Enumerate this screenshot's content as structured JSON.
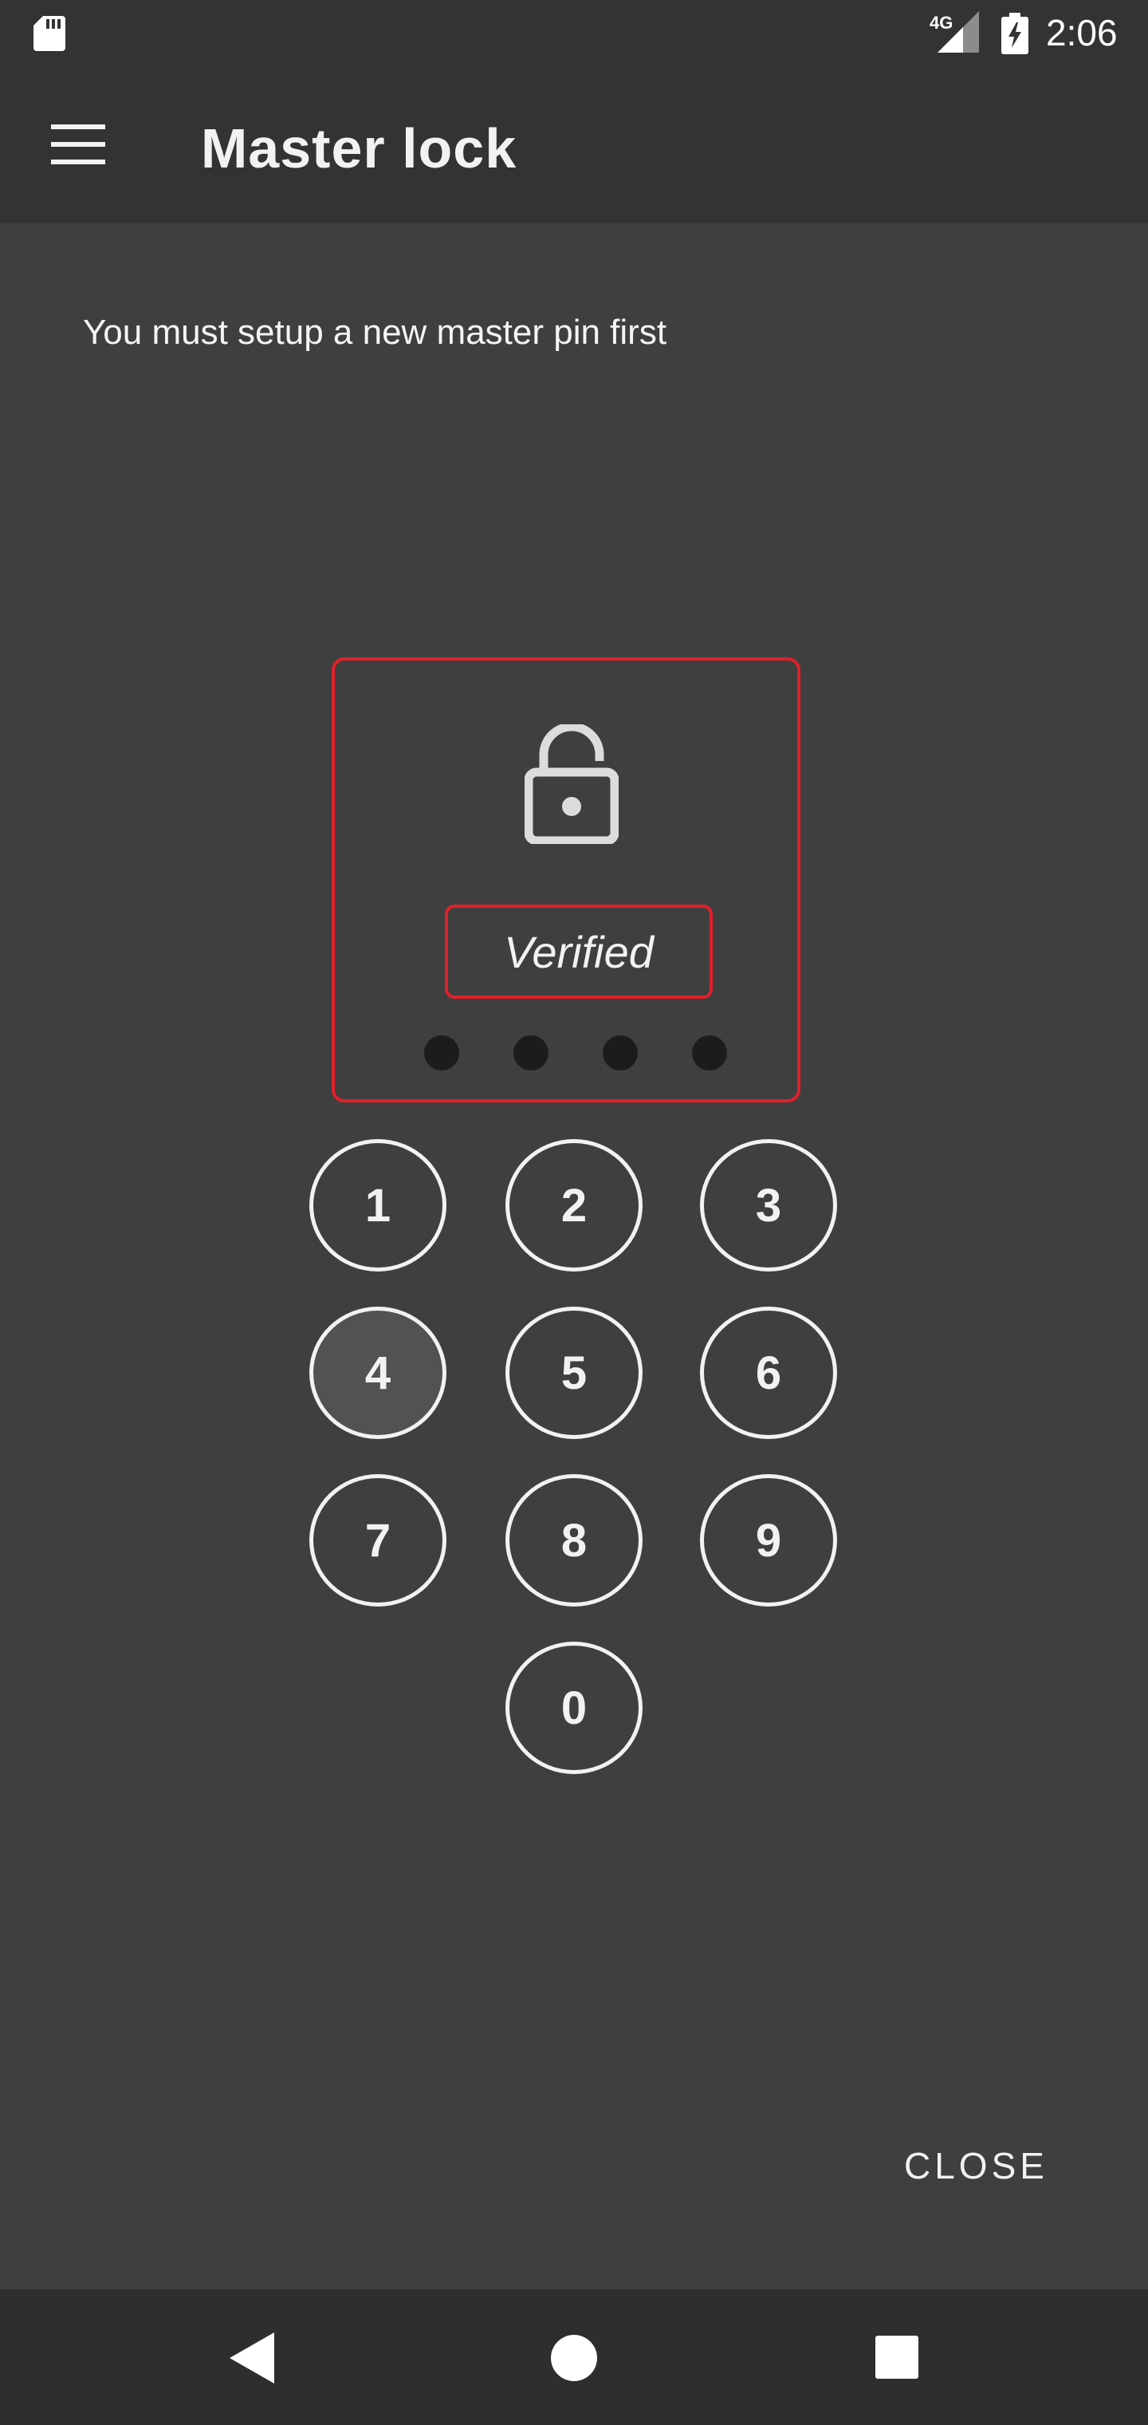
{
  "status_bar": {
    "time": "2:06",
    "network_type": "4G",
    "icons": [
      "sd-card-icon",
      "signal-icon",
      "battery-charging-icon"
    ]
  },
  "app_bar": {
    "title": "Master lock",
    "menu_icon": "menu-icon"
  },
  "main": {
    "message": "You must setup a new master pin first",
    "lock": {
      "icon": "unlocked-padlock-icon",
      "status": "Verified",
      "pin_length": 4,
      "accent_color": "#e0202a"
    },
    "keypad": {
      "keys": [
        "1",
        "2",
        "3",
        "4",
        "5",
        "6",
        "7",
        "8",
        "9",
        "0"
      ],
      "pressed_key": "4"
    },
    "close_label": "CLOSE"
  },
  "nav_bar": {
    "icons": [
      "back-icon",
      "home-icon",
      "recents-icon"
    ]
  }
}
